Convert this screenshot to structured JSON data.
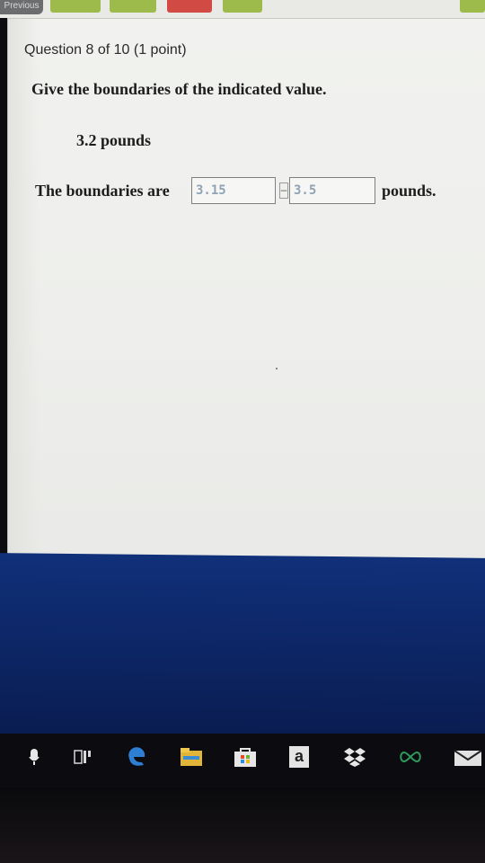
{
  "nav": {
    "prev_label": "Previous",
    "box_colors": [
      "#9dbb4a",
      "#9dbb4a",
      "#d24a44",
      "#9dbb4a",
      "#9dbb4a"
    ]
  },
  "question": {
    "header": "Question 8 of 10 (1 point)",
    "prompt": "Give the boundaries of the indicated value.",
    "value": "3.2 pounds",
    "answer_prefix": "The boundaries are",
    "lower_value": "3.15",
    "upper_value": "3.5",
    "separator": "–",
    "answer_suffix": "pounds."
  },
  "taskbar": {
    "icons": [
      "microphone-icon",
      "task-view-icon",
      "edge-icon",
      "file-explorer-icon",
      "store-icon",
      "amazon-icon",
      "dropbox-icon",
      "infinity-icon",
      "mail-icon"
    ],
    "amazon_letter": "a"
  },
  "colors": {
    "desktop": "#10307a",
    "input_text": "#8fa3b6"
  }
}
